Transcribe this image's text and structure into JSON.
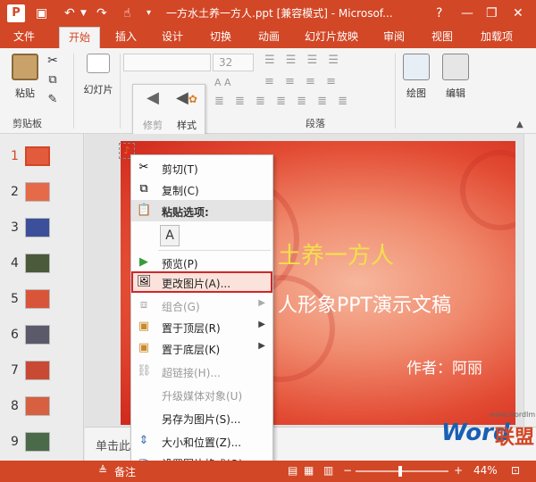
{
  "window": {
    "title": "一方水土养一方人.ppt [兼容模式] - Microsof...",
    "help": "?",
    "minimize": "—",
    "restore": "❐",
    "close": "✕"
  },
  "tabs": [
    "文件",
    "开始",
    "插入",
    "设计",
    "切换",
    "动画",
    "幻灯片放映",
    "审阅",
    "视图",
    "加载项"
  ],
  "ribbon": {
    "paste_label": "粘贴",
    "clipboard_label": "剪贴板",
    "slides_label": "幻灯片",
    "font_size": "32",
    "paragraph_label": "段落",
    "draw_label": "绘图",
    "edit_label": "编辑"
  },
  "mini_toolbar": {
    "trim_label": "修剪",
    "style_label": "样式"
  },
  "thumbnails": [
    "1",
    "2",
    "3",
    "4",
    "5",
    "6",
    "7",
    "8",
    "9"
  ],
  "slide": {
    "title": "土养一方人",
    "subtitle": "人形象PPT演示文稿",
    "author": "作者：阿丽"
  },
  "notes": {
    "text": "单击此"
  },
  "context_menu": {
    "cut": "剪切(T)",
    "copy": "复制(C)",
    "paste_options": "粘贴选项:",
    "preview": "预览(P)",
    "change_picture": "更改图片(A)...",
    "group": "组合(G)",
    "bring_front": "置于顶层(R)",
    "send_back": "置于底层(K)",
    "hyperlink": "超链接(H)...",
    "upgrade_media": "升级媒体对象(U)",
    "save_as_picture": "另存为图片(S)...",
    "size_position": "大小和位置(Z)...",
    "format_picture": "设置图片格式(O)..."
  },
  "status": {
    "notes_label": "备注",
    "zoom": "44%",
    "minus": "−",
    "plus": "+"
  },
  "watermark": {
    "word": "Word",
    "cn": "联盟",
    "url": "www.wordlm.com"
  },
  "colors": {
    "accent": "#d24726",
    "highlight": "#d0262a"
  }
}
